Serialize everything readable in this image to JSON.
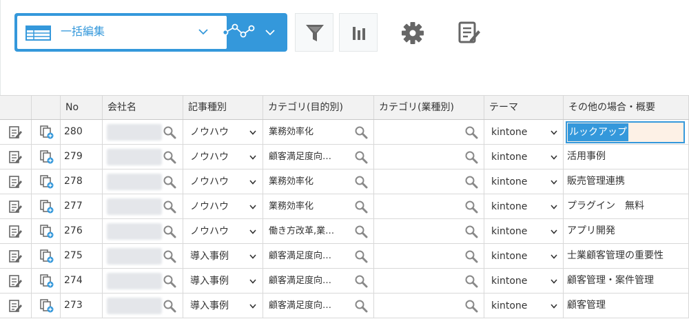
{
  "toolbar": {
    "view_name": "一括編集",
    "view_icon": "table-grid-icon",
    "graph_icon": "graph-nodes-icon",
    "buttons": [
      {
        "name": "filter-icon"
      },
      {
        "name": "bar-chart-icon"
      },
      {
        "name": "gear-icon"
      },
      {
        "name": "edit-form-icon"
      }
    ]
  },
  "table": {
    "headers": [
      "No",
      "会社名",
      "記事種別",
      "カテゴリ(目的別)",
      "カテゴリ(業種別)",
      "テーマ",
      "その他の場合・概要"
    ],
    "rows": [
      {
        "no": "280",
        "type": "ノウハウ",
        "cat1": "業務効率化",
        "theme": "kintone",
        "other": "ルックアップ"
      },
      {
        "no": "279",
        "type": "ノウハウ",
        "cat1": "顧客満足度向…",
        "theme": "kintone",
        "other": "活用事例"
      },
      {
        "no": "278",
        "type": "ノウハウ",
        "cat1": "業務効率化",
        "theme": "kintone",
        "other": "販売管理連携"
      },
      {
        "no": "277",
        "type": "ノウハウ",
        "cat1": "業務効率化",
        "theme": "kintone",
        "other": "プラグイン　無料"
      },
      {
        "no": "276",
        "type": "ノウハウ",
        "cat1": "働き方改革,業…",
        "theme": "kintone",
        "other": "アプリ開発"
      },
      {
        "no": "275",
        "type": "導入事例",
        "cat1": "顧客満足度向…",
        "theme": "kintone",
        "other": "士業顧客管理の重要性"
      },
      {
        "no": "274",
        "type": "導入事例",
        "cat1": "顧客満足度向…",
        "theme": "kintone",
        "other": "顧客管理・案件管理"
      },
      {
        "no": "273",
        "type": "導入事例",
        "cat1": "顧客満足度向…",
        "theme": "kintone",
        "other": "顧客管理"
      }
    ]
  },
  "colors": {
    "accent": "#3498db",
    "header_bg": "#f2f2f2",
    "icon_gray": "#666666"
  }
}
